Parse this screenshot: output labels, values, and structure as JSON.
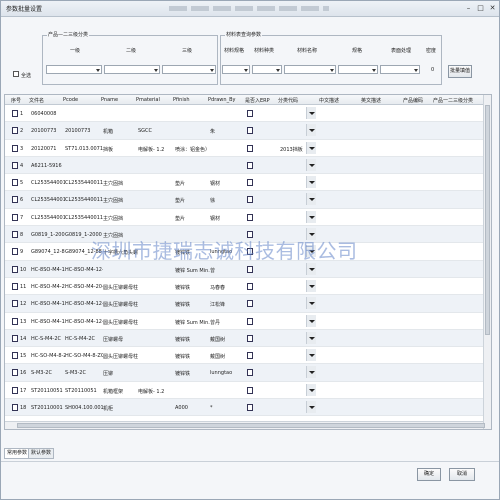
{
  "window": {
    "title": "参数批量设置"
  },
  "filter": {
    "group1_legend": "产品—二三级分类",
    "level1_label": "一级",
    "level2_label": "二级",
    "level3_label": "三级",
    "group2_legend": "材料表查询参数",
    "material_spec_label": "材料规格",
    "material_type_label": "材料种类",
    "material_name_label": "材料名称",
    "spec_label": "规格",
    "surface_label": "表面处理",
    "density_label": "密度",
    "density_value": "0",
    "select_all_label": "全选",
    "batch_apply_label": "批量填值"
  },
  "columns": [
    "序号",
    "文件名",
    "Pcode",
    "Pname",
    "Pmaterial",
    "Pfinish",
    "Pdrawn_By",
    "是否入ERP",
    "分类代码",
    "中文描述",
    "英文描述",
    "产品编码",
    "产品一二三级分类"
  ],
  "rows": [
    {
      "no": "1",
      "file": "06040008",
      "pcode": "",
      "pname": "",
      "pmat": "",
      "pfin": "",
      "pdrawn": "",
      "cat": ""
    },
    {
      "no": "2",
      "file": "20100773",
      "pcode": "20100773",
      "pname": "机箱",
      "pmat": "SGCC",
      "pfin": "",
      "pdrawn": "朱",
      "cat": ""
    },
    {
      "no": "3",
      "file": "20120071",
      "pcode": "ST71.013.0071",
      "pname": "挡板",
      "pmat": "电解板- 1.2",
      "pfin": "喷涂：铝金色）双 千",
      "pdrawn": "",
      "cat": "2013挡板"
    },
    {
      "no": "4",
      "file": "A6211-5916",
      "pcode": "",
      "pname": "",
      "pmat": "",
      "pfin": "",
      "pdrawn": "",
      "cat": ""
    },
    {
      "no": "5",
      "file": "CL2535440011",
      "pcode": "CL2535440011-2",
      "pname": "主穴固挡",
      "pmat": "",
      "pfin": "垫片",
      "pdrawn": "钢材",
      "cat": ""
    },
    {
      "no": "6",
      "file": "CL2535440011-2",
      "pcode": "CL2535440011-2",
      "pname": "主穴固挡",
      "pmat": "",
      "pfin": "垫片",
      "pdrawn": "徐",
      "cat": ""
    },
    {
      "no": "7",
      "file": "CL2535440011-3",
      "pcode": "CL2535440011-3",
      "pname": "主穴固挡",
      "pmat": "",
      "pfin": "垫片",
      "pdrawn": "钢材",
      "cat": ""
    },
    {
      "no": "8",
      "file": "G0819_1-2000_MOK",
      "pcode": "G0819_1-2000",
      "pname": "主穴固挡",
      "pmat": "",
      "pfin": "",
      "pdrawn": "",
      "cat": ""
    },
    {
      "no": "9",
      "file": "G89074_12-88_MOK",
      "pcode": "G89074_12-88",
      "pname": "十字槽六角头螺栓-垫圈",
      "pmat": "",
      "pfin": "镀锌铁",
      "pdrawn": "lunngtao",
      "cat": ""
    },
    {
      "no": "10",
      "file": "HC-8SO-M4-12-ZC-ST",
      "pcode": "HC-8SO-M4-12-ZC",
      "pname": "",
      "pmat": "",
      "pfin": "镀锌 Sum Min.",
      "pdrawn": "曾",
      "cat": ""
    },
    {
      "no": "11",
      "file": "HC-8SO-M4-20-ZC",
      "pcode": "HC-8SO-M4-20-ZC",
      "pname": "圆头压铆螺母柱",
      "pmat": "",
      "pfin": "镀锌铁",
      "pdrawn": "马春春",
      "cat": ""
    },
    {
      "no": "12",
      "file": "HC-8SO-M4-12-ZC",
      "pcode": "HC-8SO-M4-12-ZC",
      "pname": "圆头压铆螺母柱",
      "pmat": "",
      "pfin": "镀锌铁",
      "pdrawn": "江松锋",
      "cat": ""
    },
    {
      "no": "13",
      "file": "HC-8SO-M4-12-ZC-84",
      "pcode": "HC-8SO-M4-12-ZC",
      "pname": "圆头压铆螺母柱",
      "pmat": "",
      "pfin": "镀锌 Sum Min.",
      "pdrawn": "曾丹",
      "cat": ""
    },
    {
      "no": "14",
      "file": "HC-S-M4-2C",
      "pcode": "HC-S-M4-2C",
      "pname": "压铆螺母",
      "pmat": "",
      "pfin": "镀锌铁",
      "pdrawn": "戴国树",
      "cat": ""
    },
    {
      "no": "15",
      "file": "HC-SO-M4-8-ZC",
      "pcode": "HC-SO-M4-8-ZC",
      "pname": "圆头压铆螺母柱",
      "pmat": "",
      "pfin": "镀锌铁",
      "pdrawn": "戴国树",
      "cat": ""
    },
    {
      "no": "16",
      "file": "S-M3-2C",
      "pcode": "S-M3-2C",
      "pname": "压铆",
      "pmat": "",
      "pfin": "镀锌铁",
      "pdrawn": "lunngtao",
      "cat": ""
    },
    {
      "no": "17",
      "file": "ST20110051",
      "pcode": "ST20110051",
      "pname": "机箱框架",
      "pmat": "电解板- 1.2",
      "pfin": "",
      "pdrawn": "",
      "cat": ""
    },
    {
      "no": "18",
      "file": "ST20110001",
      "pcode": "SH004.100.0017",
      "pname": "机柜",
      "pmat": "",
      "pfin": "A000",
      "pdrawn": "*",
      "cat": ""
    }
  ],
  "tabs": [
    "常用参数",
    "默认参数"
  ],
  "footer": {
    "ok_label": "确定",
    "cancel_label": "取消"
  },
  "watermark": "深圳市捷瑞志诚科技有限公司"
}
